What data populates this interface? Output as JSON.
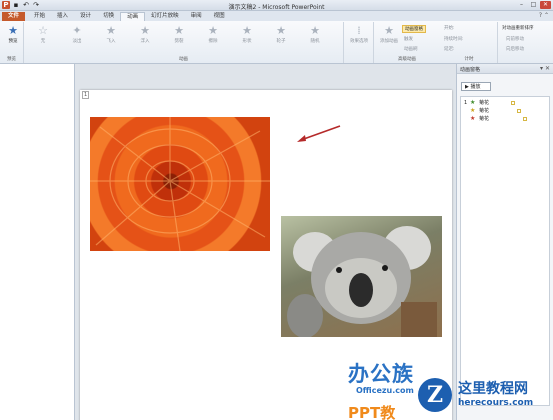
{
  "window": {
    "title": "演示文稿2 - Microsoft PowerPoint",
    "app_icon": "P"
  },
  "tabs": [
    {
      "label": "文件"
    },
    {
      "label": "开始"
    },
    {
      "label": "插入"
    },
    {
      "label": "设计"
    },
    {
      "label": "切换"
    },
    {
      "label": "动画"
    },
    {
      "label": "幻灯片放映"
    },
    {
      "label": "审阅"
    },
    {
      "label": "视图"
    }
  ],
  "ribbon": {
    "preview_label": "预览",
    "preview_group": "预览",
    "animation_effects": [
      "无",
      "淡出",
      "飞入",
      "浮入",
      "劈裂",
      "擦除",
      "形状",
      "轮子",
      "随机"
    ],
    "animation_group": "动画",
    "effect_options": "效果选项",
    "add_animation": "添加动画",
    "animation_pane_btn": "动画窗格",
    "trigger": "触发",
    "painter": "动画刷",
    "advanced_group": "高级动画",
    "start_label": "开始:",
    "duration_label": "持续时间:",
    "delay_label": "延迟:",
    "reorder_label": "对动画重新排序",
    "move_earlier": "向前移动",
    "move_later": "向后移动",
    "timing_group": "计时"
  },
  "slide": {
    "anim_tag": "1",
    "logo_line1": "办公族",
    "logo_line2": "Officezu.com",
    "logo_line3": "PPT教"
  },
  "watermark": {
    "circle_letter": "Z",
    "zh": "这里教程网",
    "en": "herecours.com"
  },
  "pane": {
    "title": "动画窗格",
    "play_label": "播放",
    "items": [
      {
        "num": "1",
        "label": "菊花"
      },
      {
        "num": "",
        "label": "菊花"
      },
      {
        "num": "",
        "label": "菊花"
      }
    ]
  }
}
